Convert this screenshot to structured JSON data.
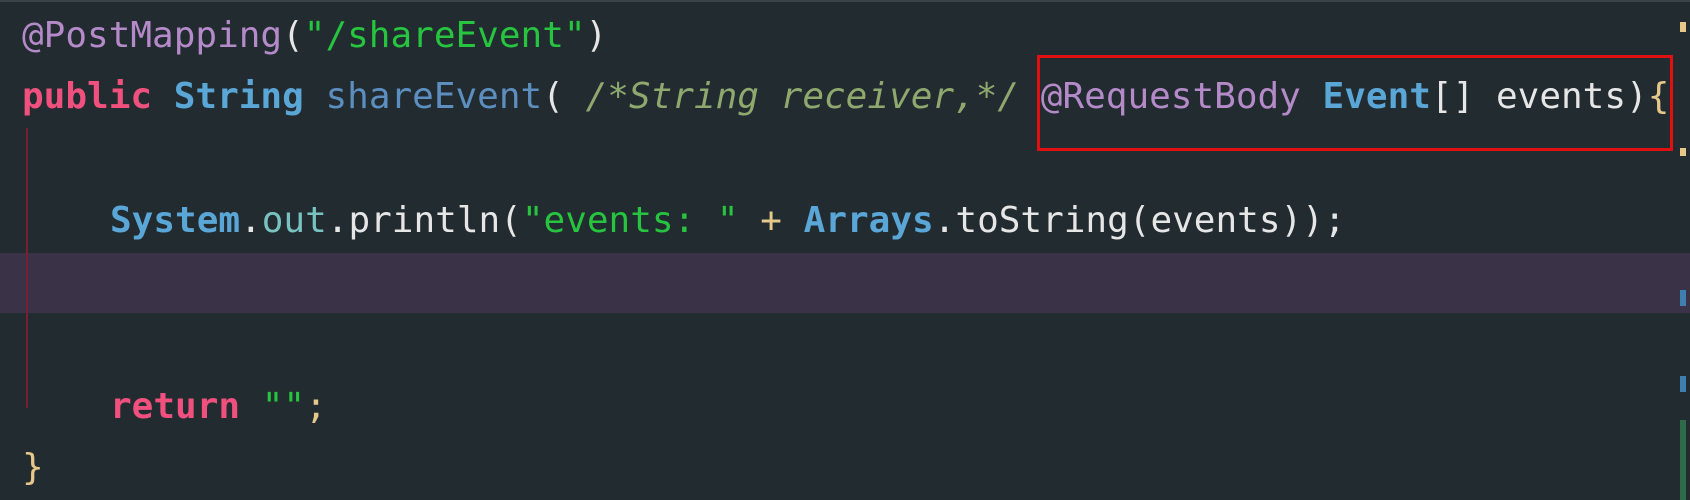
{
  "code": {
    "line1": {
      "annotation": "@PostMapping",
      "open": "(",
      "string": "\"/shareEvent\"",
      "close": ")"
    },
    "line2": {
      "kw_public": "public",
      "type_string": "String",
      "method": "shareEvent",
      "open": "(",
      "comment": "/*String receiver,*/",
      "annotation": "@RequestBody",
      "type_event": "Event",
      "brackets": "[]",
      "param": "events",
      "close": ")",
      "brace": "{"
    },
    "line3": {
      "system": "System",
      "dot1": ".",
      "out": "out",
      "dot2": ".",
      "println": "println(",
      "string": "\"events: \"",
      "plus": "+",
      "arrays": "Arrays",
      "dot3": ".",
      "tostring": "toString(events));"
    },
    "line4": {
      "kw_return": "return",
      "string": "\"\"",
      "semicolon": ";"
    },
    "line5": {
      "brace": "}"
    }
  },
  "colors": {
    "background": "#212b30",
    "current_line": "#3a3246",
    "highlight_box": "#e01010",
    "annotation": "#b58ac9",
    "string": "#27c43f",
    "keyword": "#f0507e",
    "type": "#5aa6d6"
  }
}
